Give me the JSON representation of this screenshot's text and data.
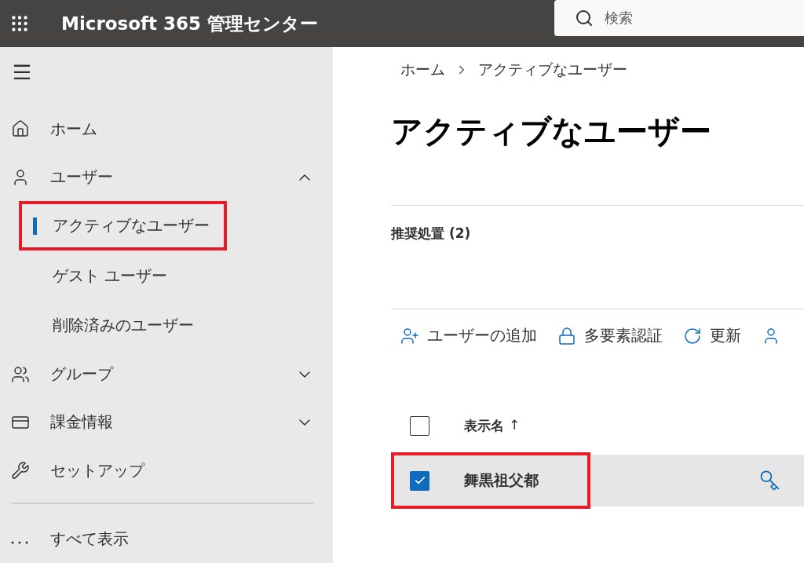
{
  "topbar": {
    "app_title": "Microsoft 365 管理センター",
    "search": {
      "placeholder": "検索"
    }
  },
  "sidebar": {
    "items": [
      {
        "kind": "home",
        "label": "ホーム"
      },
      {
        "kind": "users",
        "label": "ユーザー",
        "expanded": true,
        "children": [
          {
            "label": "アクティブなユーザー",
            "selected": true,
            "highlighted": true
          },
          {
            "label": "ゲスト ユーザー",
            "selected": false,
            "highlighted": false
          },
          {
            "label": "削除済みのユーザー",
            "selected": false,
            "highlighted": false
          }
        ]
      },
      {
        "kind": "groups",
        "label": "グループ",
        "expanded": false
      },
      {
        "kind": "billing",
        "label": "課金情報",
        "expanded": false
      },
      {
        "kind": "setup",
        "label": "セットアップ"
      }
    ],
    "show_all": "すべて表示"
  },
  "breadcrumb": [
    "ホーム",
    "アクティブなユーザー"
  ],
  "page_title": "アクティブなユーザー",
  "recommended": "推奨処置 (2)",
  "toolbar": [
    {
      "kind": "add-user",
      "label": "ユーザーの追加"
    },
    {
      "kind": "lock",
      "label": "多要素認証"
    },
    {
      "kind": "refresh",
      "label": "更新"
    },
    {
      "kind": "user"
    }
  ],
  "table": {
    "header_checked": false,
    "columns": [
      {
        "label": "表示名",
        "sort_mark": "↑"
      }
    ],
    "rows": [
      {
        "name": "舞黒祖父都",
        "checked": true,
        "highlighted": true,
        "selected": true
      }
    ]
  }
}
